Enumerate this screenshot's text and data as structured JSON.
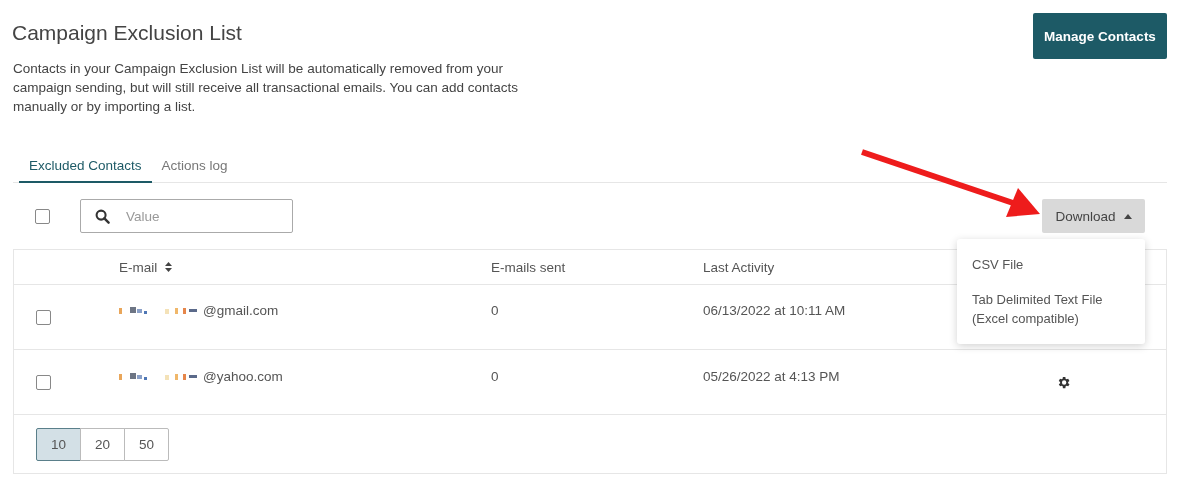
{
  "header": {
    "title": "Campaign Exclusion List",
    "description": "Contacts in your Campaign Exclusion List will be automatically removed from your campaign sending, but will still receive all transactional emails. You can add contacts manually or by importing a list.",
    "primary_button": "Manage Contacts"
  },
  "tabs": [
    {
      "label": "Excluded Contacts",
      "selected": true
    },
    {
      "label": "Actions log",
      "selected": false
    }
  ],
  "toolbar": {
    "select_all_checked": false,
    "search_placeholder": "Value",
    "download_button": "Download",
    "download_menu": {
      "expanded": true,
      "items": [
        "CSV File",
        "Tab Delimited Text File (Excel compatible)"
      ]
    }
  },
  "table": {
    "columns": [
      {
        "label": "E-mail",
        "sortable": true
      },
      {
        "label": "E-mails sent",
        "sortable": false
      },
      {
        "label": "Last Activity",
        "sortable": false
      }
    ],
    "rows": [
      {
        "checked": false,
        "email_redacted": true,
        "email": "@gmail.com",
        "emails_sent": "0",
        "last_activity": "06/13/2022 at 10:11 AM",
        "settings_icon": false
      },
      {
        "checked": false,
        "email_redacted": true,
        "email": "@yahoo.com",
        "emails_sent": "0",
        "last_activity": "05/26/2022 at 4:13 PM",
        "settings_icon": true
      }
    ]
  },
  "page_sizes": [
    {
      "label": "10",
      "selected": true
    },
    {
      "label": "20",
      "selected": false
    },
    {
      "label": "50",
      "selected": false
    }
  ],
  "annotation": {
    "arrow": true
  }
}
